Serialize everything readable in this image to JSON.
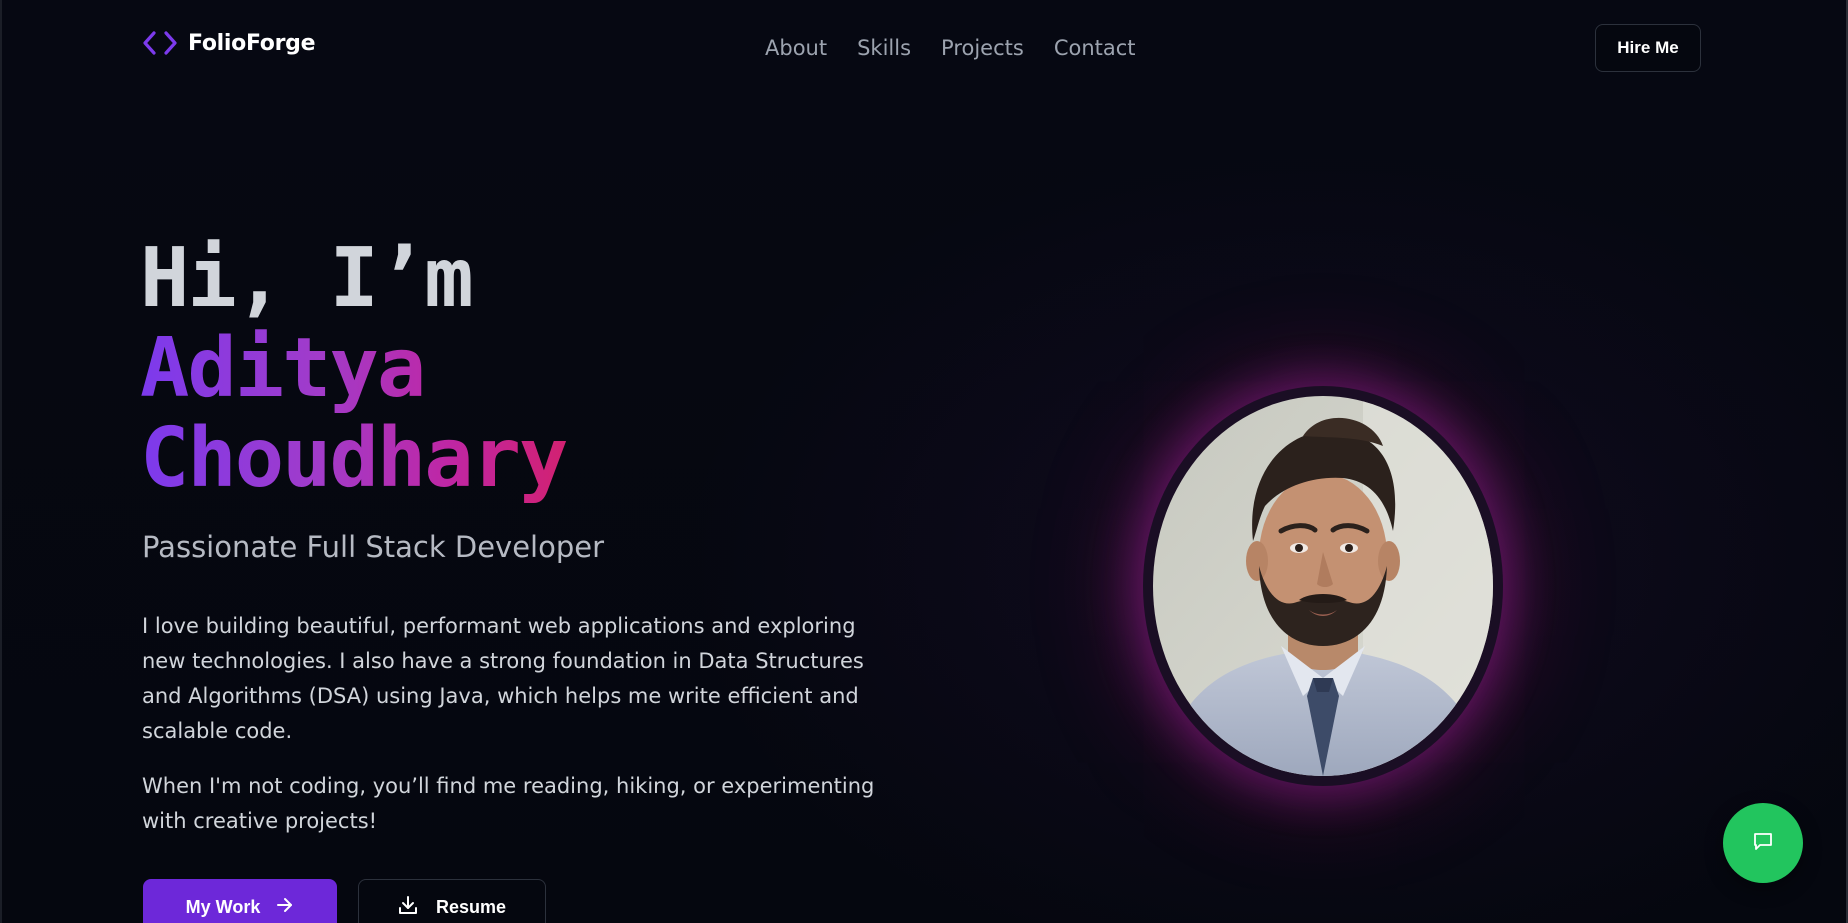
{
  "brand": {
    "logo_icon": "code-brackets-icon",
    "name": "FolioForge"
  },
  "nav": {
    "items": [
      {
        "label": "About"
      },
      {
        "label": "Skills"
      },
      {
        "label": "Projects"
      },
      {
        "label": "Contact"
      }
    ],
    "hire_label": "Hire Me"
  },
  "hero": {
    "greeting": "Hi, I’m",
    "first_name": "Aditya",
    "last_name": "Choudhary",
    "subtitle": "Passionate Full Stack Developer",
    "bio_1": "I love building beautiful, performant web applications and exploring new technologies. I also have a strong foundation in Data Structures and Algorithms (DSA) using Java, which helps me write efficient and scalable code.",
    "bio_2": "When I'm not coding, you’ll find me reading, hiking, or experimenting with creative projects!",
    "primary_cta": "My Work",
    "secondary_cta": "Resume"
  },
  "icons": {
    "primary_cta": "arrow-right-icon",
    "secondary_cta": "download-icon",
    "chat": "chat-icon"
  },
  "colors": {
    "background": "#05070f",
    "accent_purple": "#6d28d9",
    "gradient_start": "#7c3aed",
    "gradient_end": "#e11d48",
    "chat_green": "#22c55e"
  }
}
